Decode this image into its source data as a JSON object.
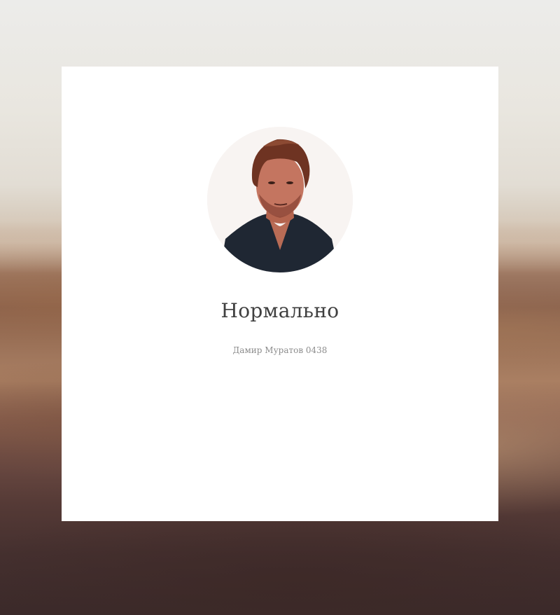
{
  "card": {
    "title": "Нормально",
    "subtitle": "Дамир Муратов 0438"
  }
}
